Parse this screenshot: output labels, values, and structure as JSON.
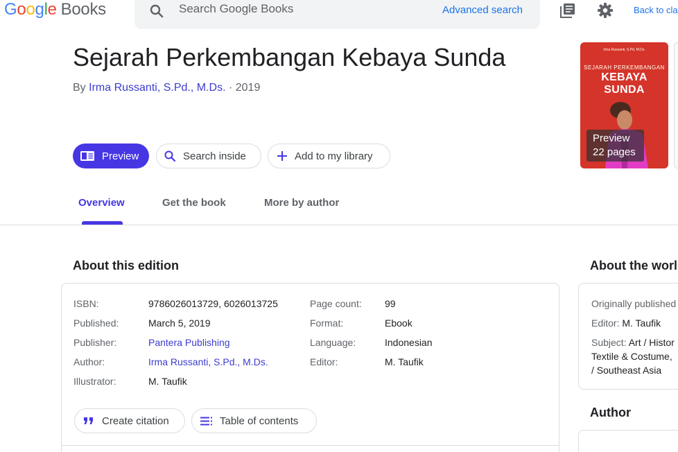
{
  "header": {
    "logo_letters": [
      "G",
      "o",
      "o",
      "g",
      "l",
      "e"
    ],
    "logo_books": "Books",
    "search_placeholder": "Search Google Books",
    "advanced_search": "Advanced search",
    "back_link": "Back to cla"
  },
  "book": {
    "title": "Sejarah Perkembangan Kebaya Sunda",
    "by_prefix": "By",
    "author": "Irma Russanti, S.Pd., M.Ds.",
    "year_sep": "· 2019"
  },
  "actions": {
    "preview": "Preview",
    "search_inside": "Search inside",
    "add_library": "Add to my library"
  },
  "tabs": [
    "Overview",
    "Get the book",
    "More by author"
  ],
  "cover": {
    "author_text": "Irma Russanti, S.Pd, M.Ds.",
    "sub_text": "SEJARAH PERKEMBANGAN",
    "main_text": "KEBAYA SUNDA",
    "badge_line1": "Preview",
    "badge_line2": "22 pages"
  },
  "edition": {
    "heading": "About this edition",
    "left_rows": [
      {
        "label": "ISBN:",
        "value": "9786026013729, 6026013725"
      },
      {
        "label": "Published:",
        "value": "March 5, 2019"
      },
      {
        "label": "Publisher:",
        "value": "Pantera Publishing"
      },
      {
        "label": "Author:",
        "value": "Irma Russanti, S.Pd., M.Ds."
      },
      {
        "label": "Illustrator:",
        "value": "M. Taufik"
      }
    ],
    "right_rows": [
      {
        "label": "Page count:",
        "value": "99"
      },
      {
        "label": "Format:",
        "value": "Ebook"
      },
      {
        "label": "Language:",
        "value": "Indonesian"
      },
      {
        "label": "Editor:",
        "value": "M. Taufik"
      }
    ],
    "create_citation": "Create citation",
    "table_of_contents": "Table of contents"
  },
  "work": {
    "heading": "About the worl",
    "originally_published": "Originally published",
    "editor_label": "Editor:",
    "editor_value": "M. Taufik",
    "subject_label": "Subject:",
    "subject_line1": "Art / Histor",
    "subject_line2": "Textile & Costume,",
    "subject_line3": "/ Southeast Asia"
  },
  "author_section": {
    "heading": "Author"
  },
  "colors": {
    "accent": "#4636e3",
    "link": "#3c3ccf",
    "google_blue": "#1a73e8"
  }
}
